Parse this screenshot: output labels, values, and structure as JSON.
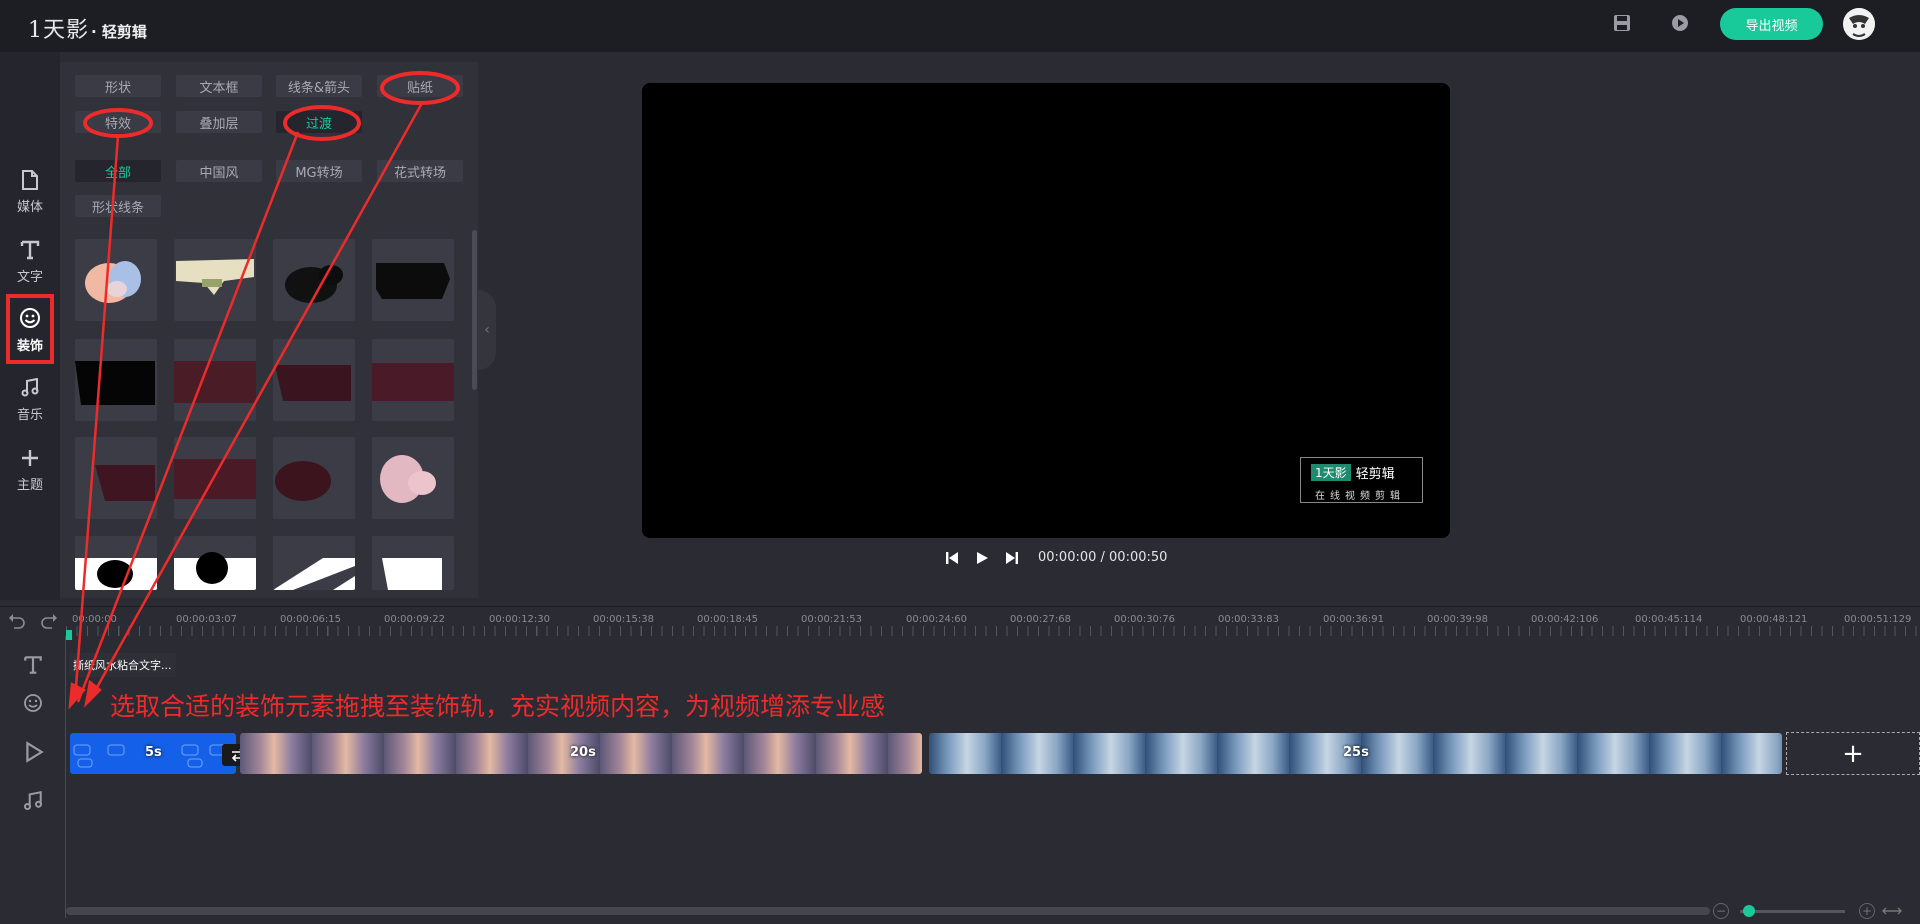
{
  "header": {
    "brand": "1天影",
    "subtitle": "· 轻剪辑",
    "export_label": "导出视频"
  },
  "nav": {
    "items": [
      {
        "label": "媒体",
        "icon": "file-icon"
      },
      {
        "label": "文字",
        "icon": "text-icon"
      },
      {
        "label": "装饰",
        "icon": "smile-icon"
      },
      {
        "label": "音乐",
        "icon": "music-icon"
      },
      {
        "label": "主题",
        "icon": "plus-icon"
      }
    ],
    "active_index": 2
  },
  "panel": {
    "category_tabs": [
      "形状",
      "文本框",
      "线条&箭头",
      "贴纸",
      "特效",
      "叠加层",
      "过渡"
    ],
    "active_category": "过渡",
    "filter_tabs": [
      "全部",
      "中国风",
      "MG转场",
      "花式转场",
      "形状线条"
    ],
    "active_filter": "全部"
  },
  "preview": {
    "watermark_brand": "1天影",
    "watermark_name": "轻剪辑",
    "watermark_slogan": "在线视频剪辑",
    "timecode": "00:00:00 / 00:00:50"
  },
  "timeline": {
    "ruler_labels": [
      "00:00:00",
      "00:00:03:07",
      "00:00:06:15",
      "00:00:09:22",
      "00:00:12:30",
      "00:00:15:38",
      "00:00:18:45",
      "00:00:21:53",
      "00:00:24:60",
      "00:00:27:68",
      "00:00:30:76",
      "00:00:33:83",
      "00:00:36:91",
      "00:00:39:98",
      "00:00:42:106",
      "00:00:45:114",
      "00:00:48:121",
      "00:00:51:129"
    ],
    "sticker_clip_label": "撕纸风水粘合文字...",
    "annotation": "选取合适的装饰元素拖拽至装饰轨，充实视频内容，为视频增添专业感",
    "clips": [
      {
        "label": "5s"
      },
      {
        "label": "20s"
      },
      {
        "label": "25s"
      }
    ],
    "add_label": "+"
  }
}
